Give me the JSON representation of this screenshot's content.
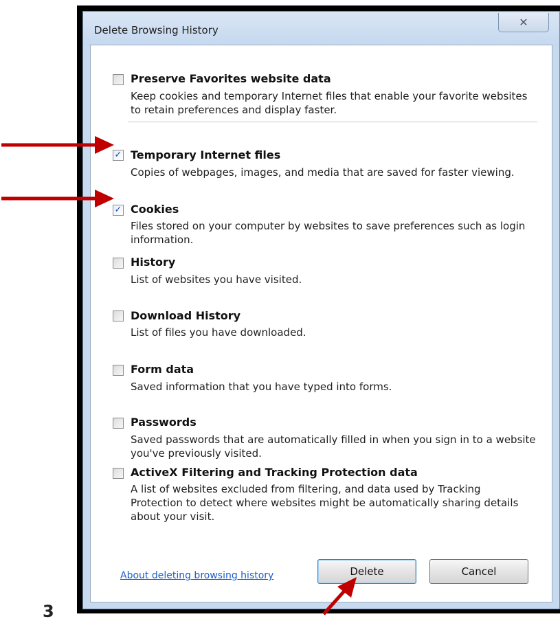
{
  "window": {
    "title": "Delete Browsing History",
    "close_glyph": "✕"
  },
  "options": [
    {
      "label": "Preserve Favorites website data",
      "checked": false,
      "description": "Keep cookies and temporary Internet files that enable your favorite websites to retain preferences and display faster."
    },
    {
      "label": "Temporary Internet files",
      "checked": true,
      "description": "Copies of webpages, images, and media that are saved for faster viewing."
    },
    {
      "label": "Cookies",
      "checked": true,
      "description": "Files stored on your computer by websites to save preferences such as login information."
    },
    {
      "label": "History",
      "checked": false,
      "description": "List of websites you have visited."
    },
    {
      "label": "Download History",
      "checked": false,
      "description": "List of files you have downloaded."
    },
    {
      "label": "Form data",
      "checked": false,
      "description": "Saved information that you have typed into forms."
    },
    {
      "label": "Passwords",
      "checked": false,
      "description": "Saved passwords that are automatically filled in when you sign in to a website you've previously visited."
    },
    {
      "label": "ActiveX Filtering and Tracking Protection data",
      "checked": false,
      "description": "A list of websites excluded from filtering, and data used by Tracking Protection to detect where websites might be automatically sharing details about your visit."
    }
  ],
  "footer": {
    "help_link": "About deleting browsing history",
    "delete_label": "Delete",
    "cancel_label": "Cancel"
  },
  "check_glyph": "✓",
  "page_mark": "3",
  "colors": {
    "arrow": "#c00000",
    "link": "#1a5fc8",
    "dialog_frame": "#c7daf0"
  }
}
